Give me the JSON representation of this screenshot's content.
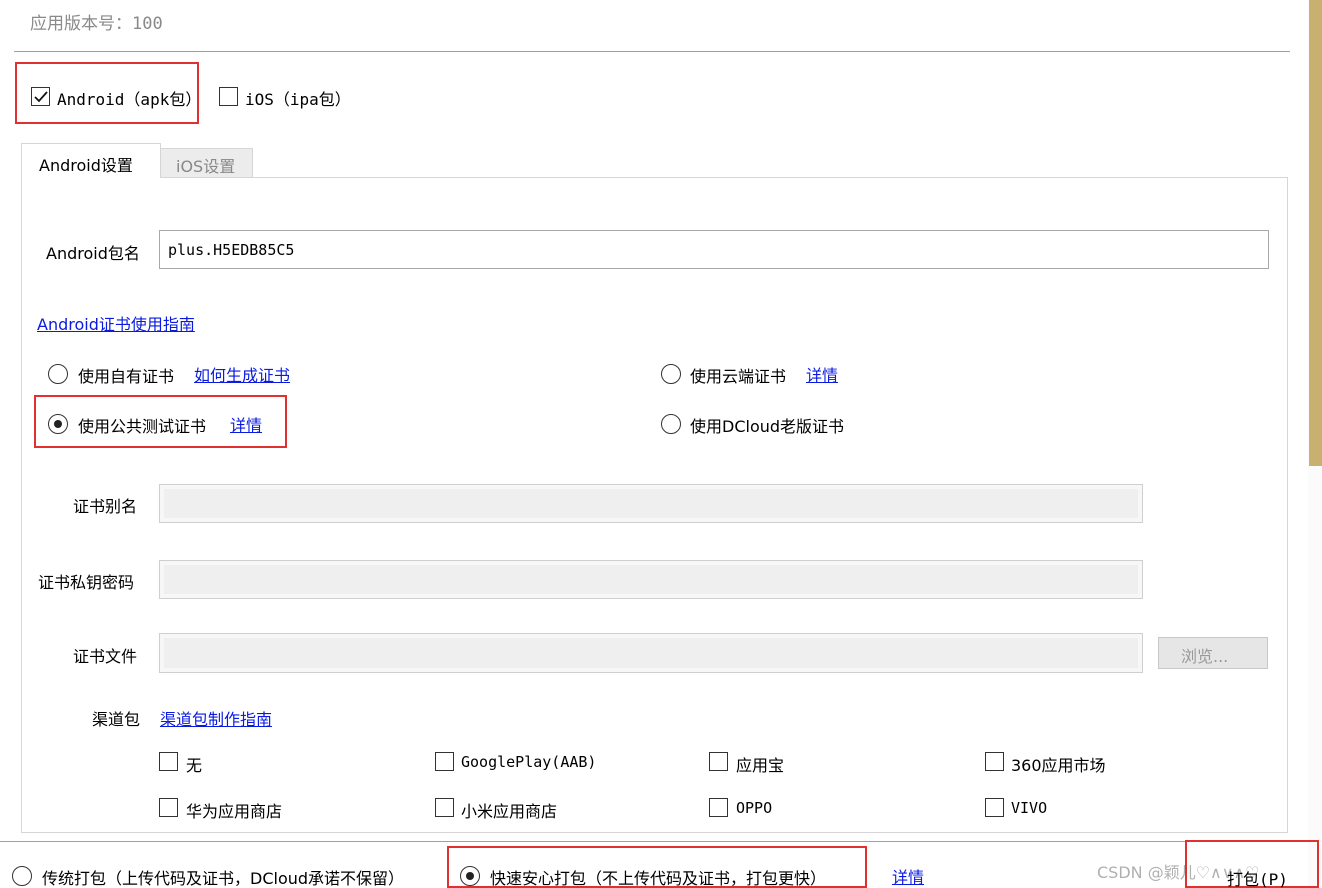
{
  "app_version": {
    "label": "应用版本号：",
    "value": "100"
  },
  "platforms": [
    {
      "label": "Android（apk包）",
      "checked": true
    },
    {
      "label": "iOS（ipa包）",
      "checked": false
    }
  ],
  "tabs": [
    {
      "label": "Android设置",
      "active": true
    },
    {
      "label": "iOS设置",
      "active": false
    }
  ],
  "package_name": {
    "label": "Android包名",
    "value": "plus.H5EDB85C5"
  },
  "cert_guide_link": "Android证书使用指南",
  "cert_options": {
    "own": {
      "label": "使用自有证书",
      "link": "如何生成证书",
      "selected": false
    },
    "cloud": {
      "label": "使用云端证书",
      "link": "详情",
      "selected": false
    },
    "public_test": {
      "label": "使用公共测试证书",
      "link": "详情",
      "selected": true
    },
    "dcloud_old": {
      "label": "使用DCloud老版证书",
      "selected": false
    }
  },
  "cert_fields": {
    "alias_label": "证书别名",
    "password_label": "证书私钥密码",
    "file_label": "证书文件",
    "browse_label": "浏览..."
  },
  "channels": {
    "label": "渠道包",
    "guide_link": "渠道包制作指南",
    "items": [
      {
        "label": "无",
        "checked": false
      },
      {
        "label": "GooglePlay(AAB)",
        "checked": false
      },
      {
        "label": "应用宝",
        "checked": false
      },
      {
        "label": "360应用市场",
        "checked": false
      },
      {
        "label": "华为应用商店",
        "checked": false
      },
      {
        "label": "小米应用商店",
        "checked": false
      },
      {
        "label": "OPPO",
        "checked": false
      },
      {
        "label": "VIVO",
        "checked": false
      }
    ]
  },
  "pack_modes": {
    "traditional": {
      "label": "传统打包（上传代码及证书，DCloud承诺不保留）",
      "selected": false
    },
    "fast": {
      "label": "快速安心打包（不上传代码及证书，打包更快）",
      "selected": true
    },
    "detail_link": "详情"
  },
  "watermark": "CSDN @颖儿♡∧∨∧♡",
  "pack_button": "打包(P)",
  "colors": {
    "highlight": "#e03030",
    "link": "#0a1ae0",
    "scrollbar": "#c8b070"
  }
}
